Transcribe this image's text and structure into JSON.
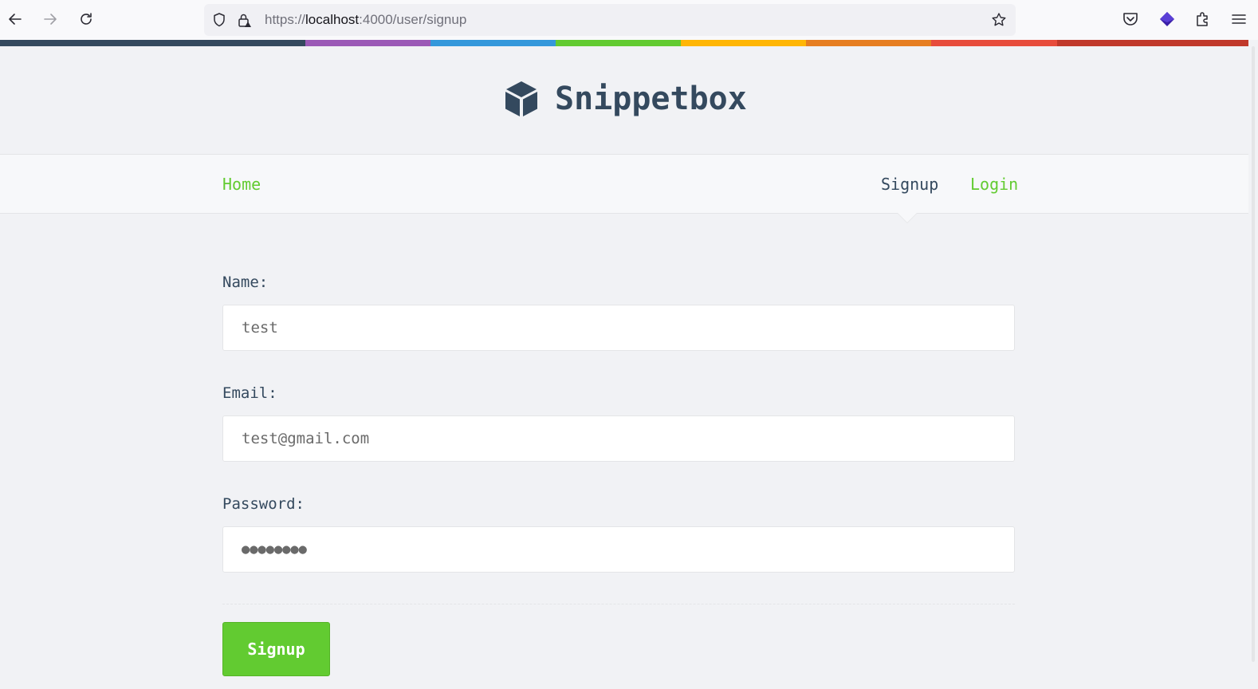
{
  "browser": {
    "url_scheme": "https://",
    "url_host": "localhost",
    "url_rest": ":4000/user/signup"
  },
  "stripe_colors": [
    "#34495e",
    "#9b59b6",
    "#3498db",
    "#62cb31",
    "#ffb606",
    "#e67e22",
    "#e74c3c",
    "#c0392b"
  ],
  "site": {
    "brand": "Snippetbox",
    "brand_color": "#34495e",
    "accent_color": "#62cb31"
  },
  "nav": {
    "home": "Home",
    "signup": "Signup",
    "login": "Login"
  },
  "form": {
    "name_label": "Name:",
    "name_value": "test",
    "email_label": "Email:",
    "email_value": "test@gmail.com",
    "password_label": "Password:",
    "password_value": "●●●●●●●●",
    "submit_label": "Signup"
  }
}
